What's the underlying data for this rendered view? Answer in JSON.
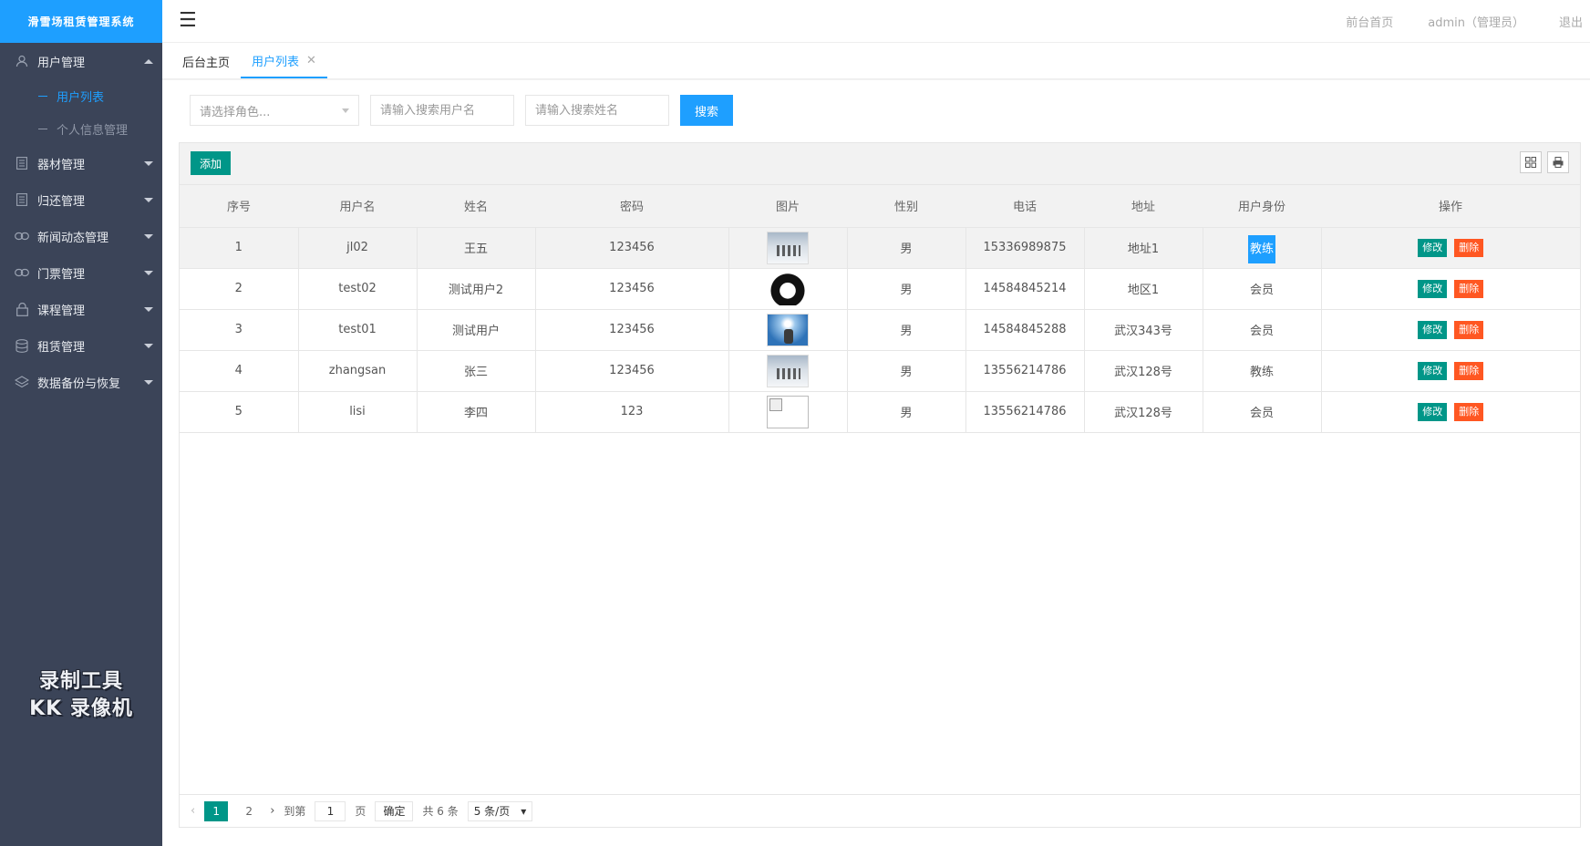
{
  "app": {
    "title": "滑雪场租赁管理系统"
  },
  "header": {
    "front_home": "前台首页",
    "user": "admin（管理员）",
    "logout": "退出"
  },
  "sidebar": {
    "items": [
      {
        "label": "用户管理",
        "icon": "user-icon",
        "open": true,
        "children": [
          {
            "label": "用户列表",
            "active": true
          },
          {
            "label": "个人信息管理",
            "active": false
          }
        ]
      },
      {
        "label": "器材管理",
        "icon": "list-icon"
      },
      {
        "label": "归还管理",
        "icon": "list-icon"
      },
      {
        "label": "新闻动态管理",
        "icon": "link-icon"
      },
      {
        "label": "门票管理",
        "icon": "link-icon"
      },
      {
        "label": "课程管理",
        "icon": "lock-icon"
      },
      {
        "label": "租赁管理",
        "icon": "database-icon"
      },
      {
        "label": "数据备份与恢复",
        "icon": "layers-icon"
      }
    ],
    "watermark_line1": "录制工具",
    "watermark_line2": "KK 录像机"
  },
  "tabs": [
    {
      "label": "后台主页",
      "active": false
    },
    {
      "label": "用户列表",
      "active": true
    }
  ],
  "search": {
    "role_placeholder": "请选择角色...",
    "username_placeholder": "请输入搜索用户名",
    "name_placeholder": "请输入搜索姓名",
    "button": "搜索"
  },
  "toolbar": {
    "add": "添加"
  },
  "table": {
    "columns": [
      "序号",
      "用户名",
      "姓名",
      "密码",
      "图片",
      "性别",
      "电话",
      "地址",
      "用户身份",
      "操作"
    ],
    "rows": [
      {
        "no": "1",
        "username": "jl02",
        "name": "王五",
        "password": "123456",
        "image": "snow",
        "gender": "男",
        "phone": "15336989875",
        "address": "地址1",
        "role": "教练"
      },
      {
        "no": "2",
        "username": "test02",
        "name": "测试用户2",
        "password": "123456",
        "image": "emblem",
        "gender": "男",
        "phone": "14584845214",
        "address": "地区1",
        "role": "会员"
      },
      {
        "no": "3",
        "username": "test01",
        "name": "测试用户",
        "password": "123456",
        "image": "ski",
        "gender": "男",
        "phone": "14584845288",
        "address": "武汉343号",
        "role": "会员"
      },
      {
        "no": "4",
        "username": "zhangsan",
        "name": "张三",
        "password": "123456",
        "image": "snow",
        "gender": "男",
        "phone": "13556214786",
        "address": "武汉128号",
        "role": "教练"
      },
      {
        "no": "5",
        "username": "lisi",
        "name": "李四",
        "password": "123",
        "image": "broken",
        "gender": "男",
        "phone": "13556214786",
        "address": "武汉128号",
        "role": "会员"
      }
    ],
    "edit_label": "修改",
    "delete_label": "删除"
  },
  "pager": {
    "pages": [
      "1",
      "2"
    ],
    "goto_label": "到第",
    "goto_value": "1",
    "page_unit": "页",
    "confirm": "确定",
    "total": "共 6 条",
    "page_size": "5 条/页"
  },
  "colors": {
    "primary": "#1e9fff",
    "teal": "#009688",
    "danger": "#ff5722",
    "sidebar_bg": "#3b4458"
  }
}
